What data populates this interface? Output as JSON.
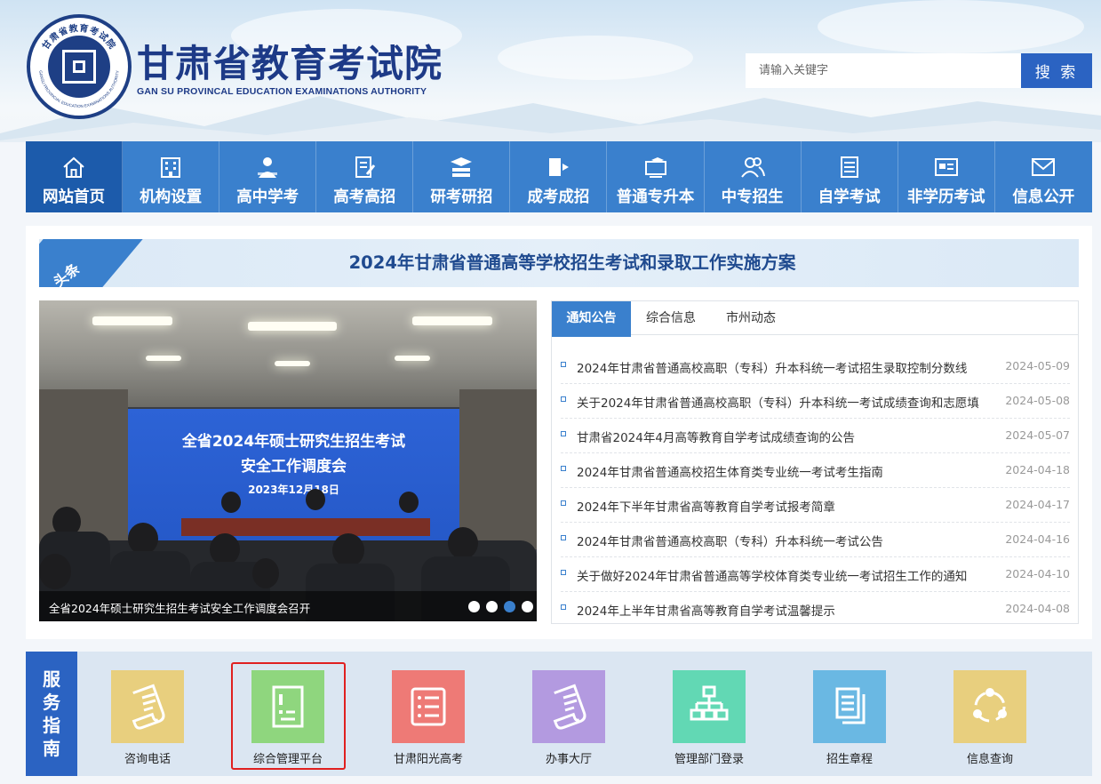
{
  "header": {
    "title": "甘肃省教育考试院",
    "subtitle": "GAN SU PROVINCAL EDUCATION EXAMINATIONS AUTHORITY",
    "seal_text": "甘肃省教育考试院",
    "seal_text_en": "GANSU PROVINCIAL EDUCATION EXAMINATIONS AUTHORITY"
  },
  "search": {
    "placeholder": "请输入关键字",
    "button_label": "搜 索"
  },
  "nav": {
    "items": [
      {
        "label": "网站首页",
        "icon": "home-icon",
        "active": true
      },
      {
        "label": "机构设置",
        "icon": "building-icon"
      },
      {
        "label": "高中学考",
        "icon": "student-icon"
      },
      {
        "label": "高考高招",
        "icon": "exam-paper-icon"
      },
      {
        "label": "研考研招",
        "icon": "books-icon"
      },
      {
        "label": "成考成招",
        "icon": "book-pen-icon"
      },
      {
        "label": "普通专升本",
        "icon": "graduate-screen-icon"
      },
      {
        "label": "中专招生",
        "icon": "users-icon"
      },
      {
        "label": "自学考试",
        "icon": "document-icon"
      },
      {
        "label": "非学历考试",
        "icon": "id-card-icon"
      },
      {
        "label": "信息公开",
        "icon": "mail-icon"
      }
    ]
  },
  "headline": {
    "tag": "头条",
    "title": "2024年甘肃省普通高等学校招生考试和录取工作实施方案"
  },
  "slideshow": {
    "screen_line1": "全省2024年硕士研究生招生考试",
    "screen_line2": "安全工作调度会",
    "screen_line3": "2023年12月18日",
    "caption": "全省2024年硕士研究生招生考试安全工作调度会召开",
    "dots": 4,
    "active_dot": 2
  },
  "notice": {
    "tabs": [
      {
        "label": "通知公告",
        "active": true
      },
      {
        "label": "综合信息"
      },
      {
        "label": "市州动态"
      }
    ],
    "items": [
      {
        "title": "2024年甘肃省普通高校高职（专科）升本科统一考试招生录取控制分数线",
        "date": "2024-05-09"
      },
      {
        "title": "关于2024年甘肃省普通高校高职（专科）升本科统一考试成绩查询和志愿填",
        "date": "2024-05-08"
      },
      {
        "title": "甘肃省2024年4月高等教育自学考试成绩查询的公告",
        "date": "2024-05-07"
      },
      {
        "title": "2024年甘肃省普通高校招生体育类专业统一考试考生指南",
        "date": "2024-04-18"
      },
      {
        "title": "2024年下半年甘肃省高等教育自学考试报考简章",
        "date": "2024-04-17"
      },
      {
        "title": "2024年甘肃省普通高校高职（专科）升本科统一考试公告",
        "date": "2024-04-16"
      },
      {
        "title": "关于做好2024年甘肃省普通高等学校体育类专业统一考试招生工作的通知",
        "date": "2024-04-10"
      },
      {
        "title": "2024年上半年甘肃省高等教育自学考试温馨提示",
        "date": "2024-04-08"
      }
    ]
  },
  "service": {
    "label_chars": [
      "服",
      "务",
      "指",
      "南"
    ],
    "items": [
      {
        "label": "咨询电话",
        "icon": "scroll-icon",
        "color": "#e8cf7e"
      },
      {
        "label": "综合管理平台",
        "icon": "checklist-icon",
        "color": "#8fd67e",
        "highlighted": true
      },
      {
        "label": "甘肃阳光高考",
        "icon": "list-icon",
        "color": "#ee7a76"
      },
      {
        "label": "办事大厅",
        "icon": "scroll-icon",
        "color": "#b39ae0"
      },
      {
        "label": "管理部门登录",
        "icon": "org-chart-icon",
        "color": "#62d8b4"
      },
      {
        "label": "招生章程",
        "icon": "documents-icon",
        "color": "#6ab8e3"
      },
      {
        "label": "信息查询",
        "icon": "share-circle-icon",
        "color": "#e8cf7e"
      }
    ]
  },
  "colors": {
    "brand_blue": "#3a80cd",
    "brand_dark": "#1c5bab",
    "title_navy": "#1d3a87",
    "highlight_red": "#e02020"
  }
}
